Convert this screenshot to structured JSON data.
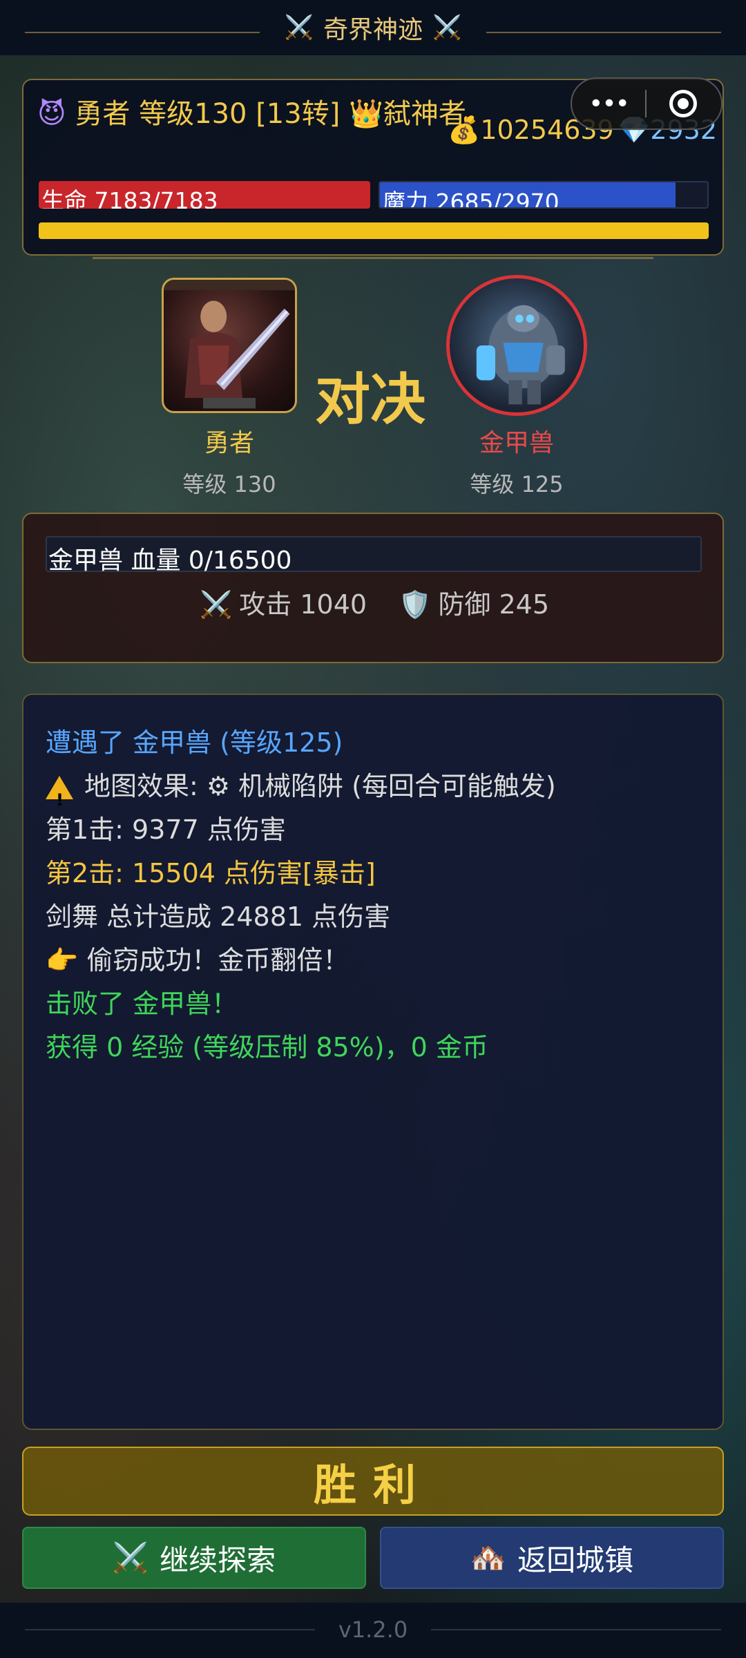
{
  "app": {
    "title": "奇界神迹",
    "title_icon": "crossed-swords-icon"
  },
  "player": {
    "emoji": "😈",
    "name_line": "勇者 等级130 [13转] 👑弑神者",
    "gold": "💰10254639",
    "gems": "💎2932",
    "hp_label": "生命 7183/7183",
    "hp_fraction": 1.0,
    "mp_label": "魔力 2685/2970",
    "mp_fraction": 0.904,
    "xp_fraction": 1.0
  },
  "miniprogram": {
    "more_label": "•••"
  },
  "battle": {
    "vs_label": "对决",
    "hero_name": "勇者",
    "hero_level": "等级 130",
    "monster_name": "金甲兽",
    "monster_level": "等级 125"
  },
  "enemy": {
    "hp_label": "金甲兽 血量 0/16500",
    "hp_fraction": 0,
    "attack_label": "攻击 1040",
    "defense_label": "防御 245"
  },
  "log": {
    "lines": [
      {
        "text": "遭遇了 金甲兽 (等级125)",
        "color": "#58a6ff"
      },
      {
        "text": "地图效果: ⚙ 机械陷阱 (每回合可能触发)",
        "color": "#dcdcdc",
        "icon": "warning-icon"
      },
      {
        "text": "第1击: 9377 点伤害",
        "color": "#dcdcdc"
      },
      {
        "text": "第2击: 15504 点伤害[暴击]",
        "color": "#f5c542"
      },
      {
        "text": "剑舞 总计造成 24881 点伤害",
        "color": "#dcdcdc"
      },
      {
        "text": "👉 偷窃成功！金币翻倍！",
        "color": "#dcdcdc"
      },
      {
        "text": "击败了 金甲兽！",
        "color": "#3fd65a"
      },
      {
        "text": "获得 0 经验 (等级压制 85%)，0 金币",
        "color": "#3fd65a"
      }
    ]
  },
  "result": {
    "label": "胜利"
  },
  "actions": {
    "explore_label": "继续探索",
    "explore_icon": "⚔️",
    "town_label": "返回城镇",
    "town_icon": "🏘️"
  },
  "footer": {
    "version": "v1.2.0"
  }
}
